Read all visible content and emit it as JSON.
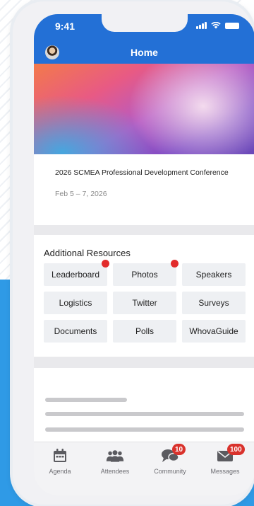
{
  "status_bar": {
    "time": "9:41"
  },
  "header": {
    "title": "Home"
  },
  "event": {
    "name": "2026 SCMEA Professional Development Conference",
    "date": "Feb 5 – 7, 2026"
  },
  "resources": {
    "title": "Additional Resources",
    "items": [
      {
        "label": "Leaderboard"
      },
      {
        "label": "Photos"
      },
      {
        "label": "Speakers"
      },
      {
        "label": "Logistics"
      },
      {
        "label": "Twitter"
      },
      {
        "label": "Surveys"
      },
      {
        "label": "Documents"
      },
      {
        "label": "Polls"
      },
      {
        "label": "WhovaGuide"
      }
    ]
  },
  "tabs": [
    {
      "label": "Agenda",
      "icon": "calendar-icon"
    },
    {
      "label": "Attendees",
      "icon": "people-icon"
    },
    {
      "label": "Community",
      "icon": "chat-bubbles-icon",
      "badge": "10"
    },
    {
      "label": "Messages",
      "icon": "envelope-icon",
      "badge": "100"
    }
  ],
  "colors": {
    "header_blue": "#2370d6",
    "badge_red": "#d9322c",
    "tab_icon_gray": "#5b5b60"
  }
}
